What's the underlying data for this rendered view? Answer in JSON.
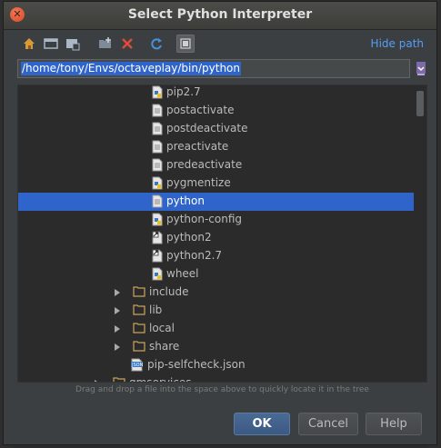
{
  "dialog": {
    "title": "Select Python Interpreter",
    "hide_path_label": "Hide path",
    "path_value": "/home/tony/Envs/octaveplay/bin/python",
    "hint": "Drag and drop a file into the space above to quickly locate it in the tree",
    "buttons": {
      "ok": "OK",
      "cancel": "Cancel",
      "help": "Help"
    }
  },
  "toolbar": {
    "icons": [
      "home-icon",
      "desktop-icon",
      "project-folder-icon",
      "new-folder-icon",
      "delete-icon",
      "refresh-icon",
      "show-hidden-files-icon"
    ]
  },
  "tree": {
    "items": [
      {
        "label": "pip2.7",
        "icon": "python-file-icon"
      },
      {
        "label": "postactivate",
        "icon": "text-file-icon"
      },
      {
        "label": "postdeactivate",
        "icon": "text-file-icon"
      },
      {
        "label": "preactivate",
        "icon": "text-file-icon"
      },
      {
        "label": "predeactivate",
        "icon": "text-file-icon"
      },
      {
        "label": "pygmentize",
        "icon": "python-file-icon"
      },
      {
        "label": "python",
        "icon": "text-file-icon",
        "selected": true
      },
      {
        "label": "python-config",
        "icon": "python-file-icon"
      },
      {
        "label": "python2",
        "icon": "symlink-file-icon"
      },
      {
        "label": "python2.7",
        "icon": "symlink-file-icon"
      },
      {
        "label": "wheel",
        "icon": "python-file-icon"
      },
      {
        "label": "include",
        "icon": "folder-icon",
        "collapsed": true
      },
      {
        "label": "lib",
        "icon": "folder-icon",
        "collapsed": true
      },
      {
        "label": "local",
        "icon": "folder-icon",
        "collapsed": true
      },
      {
        "label": "share",
        "icon": "folder-icon",
        "collapsed": true
      },
      {
        "label": "pip-selfcheck.json",
        "icon": "json-file-icon"
      },
      {
        "label": "gmservices",
        "icon": "folder-icon",
        "collapsed": true
      }
    ]
  },
  "colors": {
    "selection": "#2f65ca",
    "link": "#589df6",
    "dialog_bg": "#3c3f41",
    "tree_bg": "#2b2b2b"
  }
}
